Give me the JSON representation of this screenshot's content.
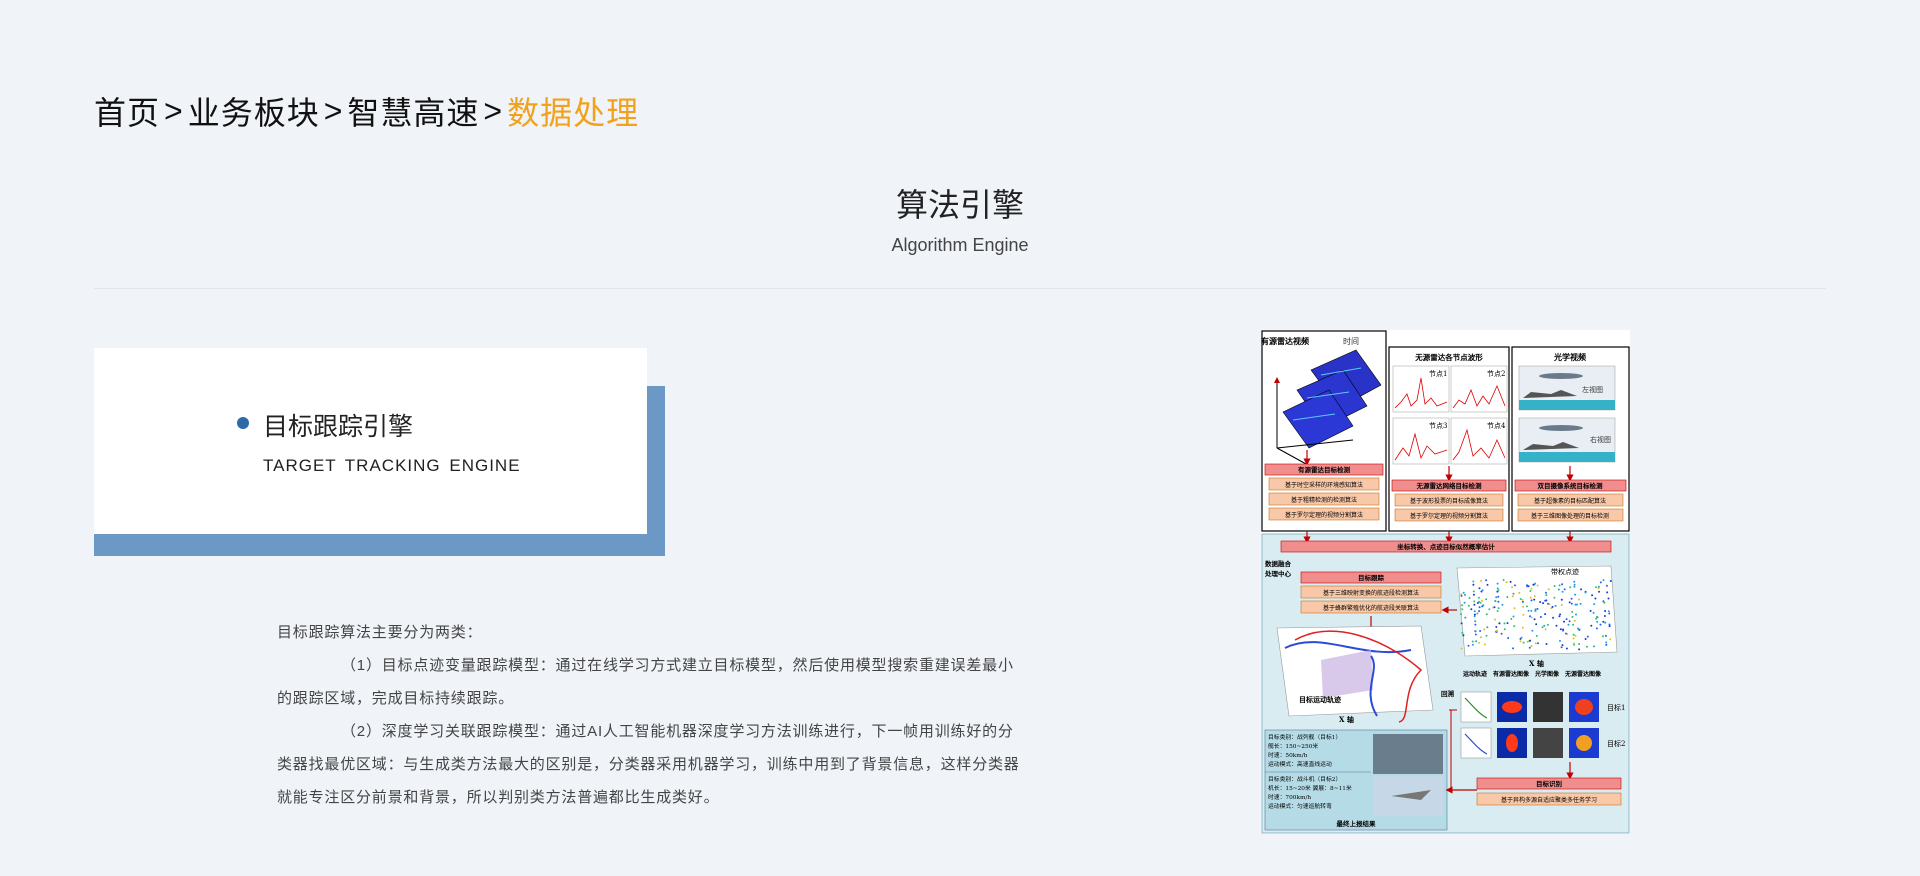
{
  "breadcrumb": {
    "items": [
      "首页",
      "业务板块",
      "智慧高速",
      "数据处理"
    ],
    "separator": ">",
    "active_color": "#f2a11c"
  },
  "section": {
    "title": "算法引擎",
    "subtitle": "Algorithm Engine"
  },
  "card": {
    "title": "目标跟踪引擎",
    "subtitle": "TARGET TRACKING ENGINE",
    "accent_color": "#6b98c4"
  },
  "description": {
    "intro": "目标跟踪算法主要分为两类：",
    "item1": "（1）目标点迹变量跟踪模型：通过在线学习方式建立目标模型，然后使用模型搜索重建误差最小的跟踪区域，完成目标持续跟踪。",
    "item2": "（2）深度学习关联跟踪模型：通过AI人工智能机器深度学习方法训练进行，下一帧用训练好的分类器找最优区域：与生成类方法最大的区别是，分类器采用机器学习，训练中用到了背景信息，这样分类器就能专注区分前景和背景，所以判别类方法普遍都比生成类好。"
  },
  "diagram": {
    "col1_title": "有源雷达视频",
    "col2_title": "无源雷达各节点波形",
    "col3_title": "光学视频",
    "time_label": "时间",
    "nodes": [
      "节点1",
      "节点2",
      "节点3",
      "节点4"
    ],
    "left_view": "左视图",
    "right_view": "右视图",
    "box1_title": "有源雷达目标检测",
    "box1_items": [
      "基于时空采样的环境感知算法",
      "基于粗精检测的检测算法",
      "基于罗尔定理的视频分割算法"
    ],
    "box2_title": "无源雷达网络目标检测",
    "box2_items": [
      "基于波形投票的目标成像算法",
      "基于罗尔定理的视频分割算法"
    ],
    "box3_title": "双目摄像系统目标检测",
    "box3_items": [
      "基于超像素的目标匹配算法",
      "基于三维图像处理的目标检测"
    ],
    "fusion_bar": "坐标转换、点迹目标似然概率估计",
    "fusion_center": [
      "数据融合",
      "处理中心"
    ],
    "track_title": "目标跟踪",
    "track_items": [
      "基于三维映射变换的航迹段检测算法",
      "基于蜂群繁殖优化的航迹段关联算法"
    ],
    "weighted_points": "带权点迹",
    "x_axis": "X 轴",
    "trajectory_label": "目标运动轨迹",
    "echo_label": "回溯",
    "img_headers": [
      "运动轨迹",
      "有源雷达图像",
      "光学图像",
      "无源雷达图像"
    ],
    "targets": [
      "目标1",
      "目标2"
    ],
    "info1": [
      "目标类别：战列舰（目标1）",
      "舰长：150~250米",
      "时速：50km/h",
      "运动模式：高速直线运动"
    ],
    "info2": [
      "目标类别：战斗机（目标2）",
      "机长：15~20米  翼展：8~11米",
      "时速：700km/h",
      "运动模式：匀速巡航转弯"
    ],
    "final_label": "最终上报结果",
    "recog_title": "目标识别",
    "recog_item": "基于异构多源自适应聚类多任务学习"
  }
}
